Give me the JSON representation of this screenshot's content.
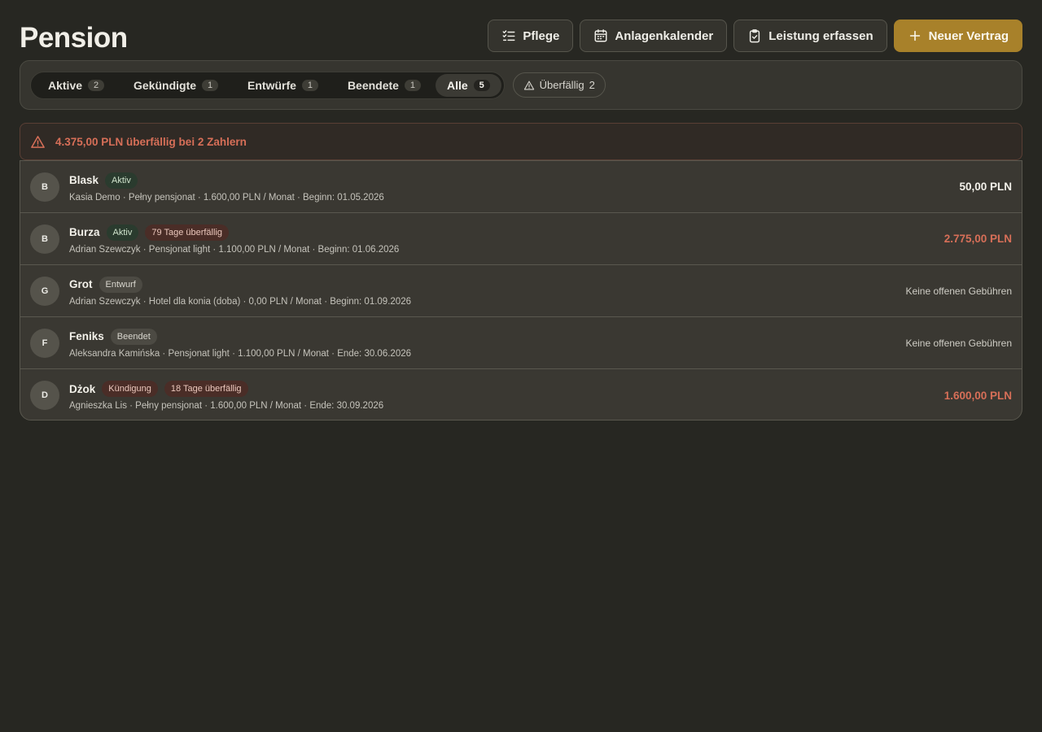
{
  "header": {
    "title": "Pension",
    "actions": {
      "care": "Pflege",
      "calendar": "Anlagenkalender",
      "record": "Leistung erfassen",
      "new_contract": "Neuer Vertrag"
    }
  },
  "filters": {
    "tabs": [
      {
        "label": "Aktive",
        "count": "2"
      },
      {
        "label": "Gekündigte",
        "count": "1"
      },
      {
        "label": "Entwürfe",
        "count": "1"
      },
      {
        "label": "Beendete",
        "count": "1"
      },
      {
        "label": "Alle",
        "count": "5"
      }
    ],
    "overdue": {
      "label": "Überfällig",
      "count": "2"
    }
  },
  "alert": {
    "text": "4.375,00 PLN überfällig bei 2 Zahlern"
  },
  "contracts": [
    {
      "initial": "B",
      "name": "Blask",
      "status": "Aktiv",
      "overdue": "",
      "details": "Kasia Demo · Pełny pensjonat · 1.600,00 PLN / Monat · Beginn: 01.05.2026",
      "amount": "50,00 PLN"
    },
    {
      "initial": "B",
      "name": "Burza",
      "status": "Aktiv",
      "overdue": "79 Tage überfällig",
      "details": "Adrian Szewczyk · Pensjonat light · 1.100,00 PLN / Monat · Beginn: 01.06.2026",
      "amount": "2.775,00 PLN"
    },
    {
      "initial": "G",
      "name": "Grot",
      "status": "Entwurf",
      "overdue": "",
      "details": "Adrian Szewczyk · Hotel dla konia (doba) · 0,00 PLN / Monat · Beginn: 01.09.2026",
      "amount": "Keine offenen Gebühren"
    },
    {
      "initial": "F",
      "name": "Feniks",
      "status": "Beendet",
      "overdue": "",
      "details": "Aleksandra Kamińska · Pensjonat light · 1.100,00 PLN / Monat · Ende: 30.06.2026",
      "amount": "Keine offenen Gebühren"
    },
    {
      "initial": "D",
      "name": "Dżok",
      "status": "Kündigung",
      "overdue": "18 Tage überfällig",
      "details": "Agnieszka Lis · Pełny pensjonat · 1.600,00 PLN / Monat · Ende: 30.09.2026",
      "amount": "1.600,00 PLN"
    }
  ],
  "colors": {
    "background": "#272722",
    "accent": "#a8812a",
    "danger": "#d76f58",
    "active_badge": "#2a3b2e"
  },
  "icons": {
    "care": "checklist-icon",
    "calendar": "calendar-icon",
    "record": "clipboard-check-icon",
    "new_contract": "plus-icon",
    "overdue": "warning-icon"
  }
}
